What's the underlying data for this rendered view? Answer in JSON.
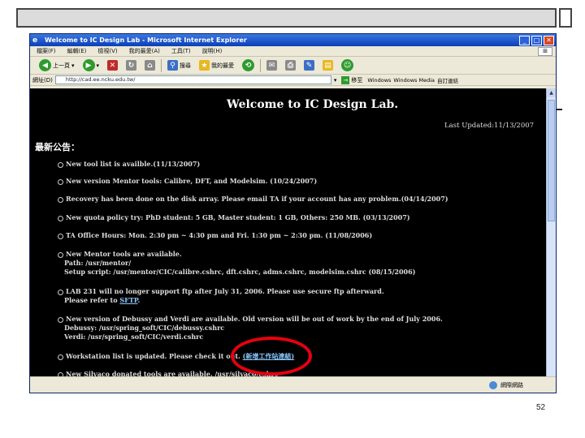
{
  "slide": {
    "page_number": "52"
  },
  "window": {
    "title": "Welcome to IC Design Lab - Microsoft Internet Explorer"
  },
  "menu": [
    "檔案(F)",
    "編輯(E)",
    "檢視(V)",
    "我的最愛(A)",
    "工具(T)",
    "說明(H)"
  ],
  "toolbar": {
    "back_label": "上一頁",
    "search_label": "搜尋",
    "favorites_label": "我的最愛"
  },
  "address": {
    "label": "網址(D)",
    "url": "http://cad.ee.ncku.edu.tw/",
    "go_label": "移至",
    "links": [
      "Windows",
      "Windows Media",
      "自訂連結"
    ]
  },
  "page": {
    "title": "Welcome to IC Design Lab.",
    "last_updated": "Last Updated:11/13/2007",
    "announce_header": "最新公告：",
    "news": [
      {
        "lines": [
          "New tool list is availble.(11/13/2007)"
        ]
      },
      {
        "lines": [
          "New version Mentor tools: Calibre, DFT, and Modelsim. (10/24/2007)"
        ]
      },
      {
        "lines": [
          "Recovery has been done on the disk array. Please email TA if your account has any problem.(04/14/2007)"
        ]
      },
      {
        "lines": [
          "New quota policy try: PhD student: 5 GB, Master student: 1 GB, Others: 250 MB. (03/13/2007)"
        ]
      },
      {
        "lines": [
          "TA Office Hours: Mon. 2:30 pm ~ 4:30 pm and Fri. 1:30 pm ~ 2:30 pm. (11/08/2006)"
        ]
      },
      {
        "lines": [
          "New Mentor tools are available.",
          "Path: /usr/mentor/",
          "Setup script: /usr/mentor/CIC/calibre.cshrc, dft.cshrc, adms.cshrc, modelsim.cshrc (08/15/2006)"
        ]
      },
      {
        "lines": [
          "LAB 231 will no longer support ftp after July 31, 2006. Please use secure ftp afterward."
        ],
        "extra_prefix": "Please refer to ",
        "extra_link": "SFTP",
        "extra_suffix": "."
      },
      {
        "lines": [
          "New version of Debussy and Verdi are available. Old version will be out of work by the end of July 2006.",
          "Debussy: /usr/spring_soft/CIC/debussy.cshrc",
          "Verdi: /usr/spring_soft/CIC/verdi.cshrc"
        ]
      },
      {
        "lines": [
          "Workstation list is updated. Please check it out."
        ],
        "inline_link": "(新增工作站連結)"
      },
      {
        "lines": [
          "New Silvaco donated tools are available. /usr/silvaco/cshrc"
        ]
      }
    ]
  },
  "status": {
    "zone": "網際網路"
  }
}
